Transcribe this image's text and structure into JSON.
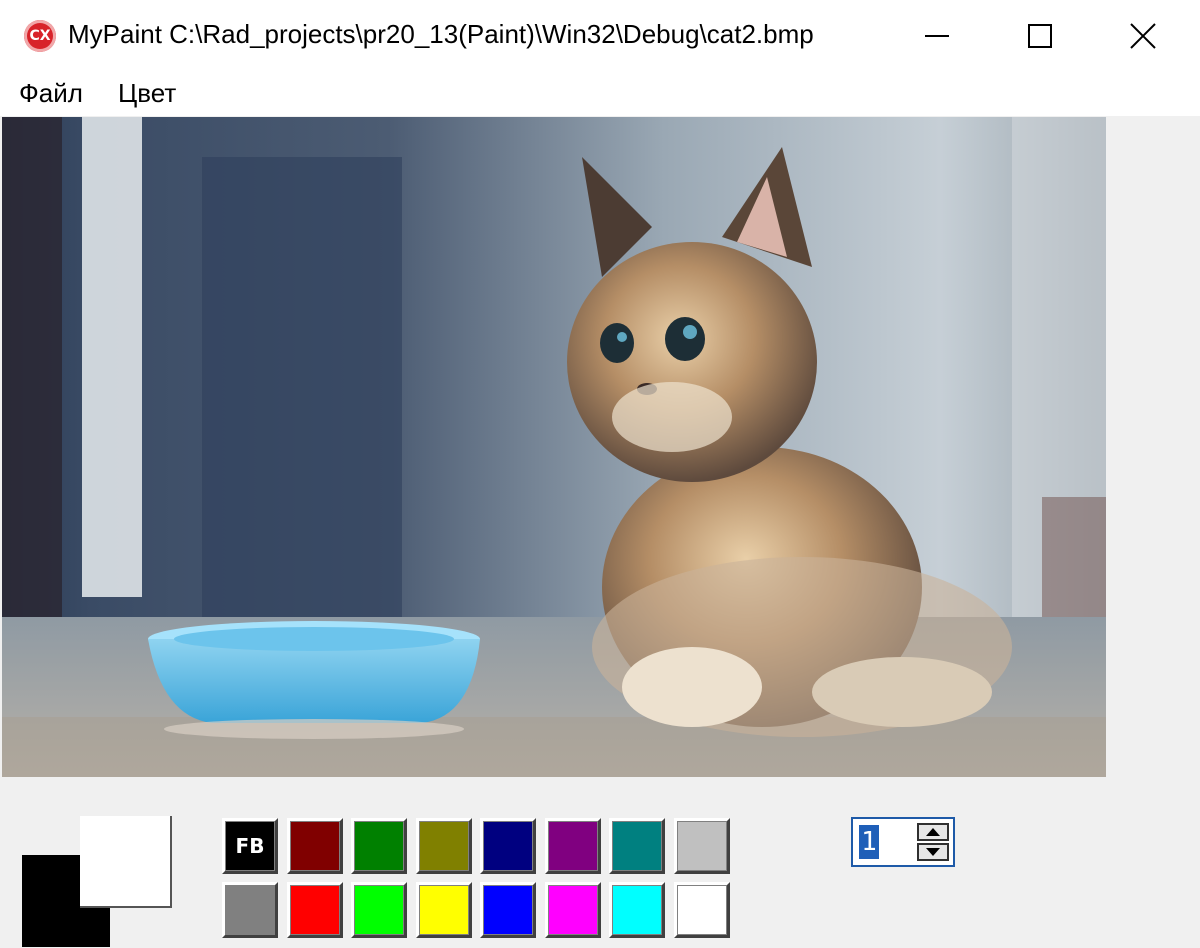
{
  "window": {
    "title": "MyPaint C:\\Rad_projects\\pr20_13(Paint)\\Win32\\Debug\\cat2.bmp",
    "app_icon_text": "CX"
  },
  "menu": {
    "items": [
      {
        "label": "Файл"
      },
      {
        "label": "Цвет"
      }
    ]
  },
  "image": {
    "subject": "kitten-beside-blue-bowl"
  },
  "colors": {
    "foreground": "#000000",
    "background": "#ffffff"
  },
  "palette": {
    "fb_label": "FB",
    "row1": [
      "#000000",
      "#800000",
      "#008000",
      "#808000",
      "#000080",
      "#800080",
      "#008080",
      "#c0c0c0"
    ],
    "row2": [
      "#808080",
      "#ff0000",
      "#00ff00",
      "#ffff00",
      "#0000ff",
      "#ff00ff",
      "#00ffff",
      "#ffffff"
    ]
  },
  "pen_width": {
    "value": "1"
  }
}
